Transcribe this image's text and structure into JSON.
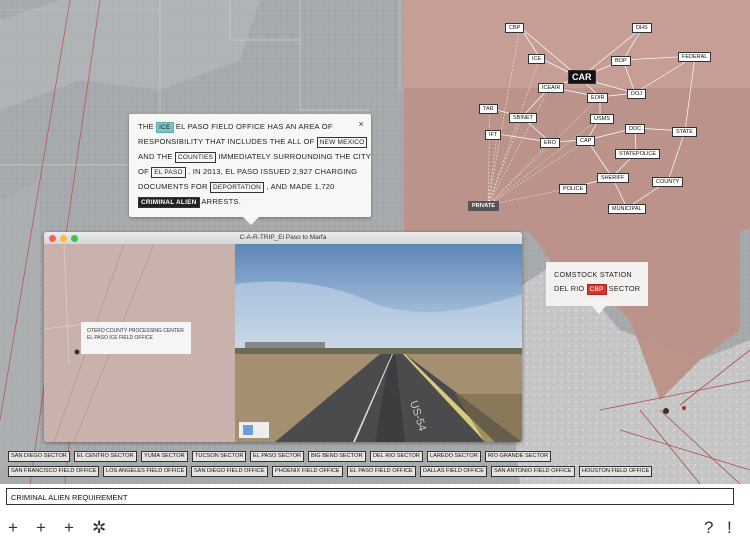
{
  "info_popup": {
    "segments": [
      {
        "type": "text",
        "v": "THE "
      },
      {
        "type": "tag",
        "cls": "ice",
        "v": "ICE"
      },
      {
        "type": "text",
        "v": " EL PASO FIELD OFFICE HAS AN AREA OF RESPONSIBILITY THAT INCLUDES THE ALL OF "
      },
      {
        "type": "tag",
        "cls": "",
        "v": "NEW MEXICO"
      },
      {
        "type": "text",
        "v": " AND THE "
      },
      {
        "type": "tag",
        "cls": "",
        "v": "COUNTIES"
      },
      {
        "type": "text",
        "v": " IMMEDIATELY SURROUNDING THE CITY OF "
      },
      {
        "type": "tag",
        "cls": "",
        "v": "EL PASO"
      },
      {
        "type": "text",
        "v": " . IN 2013, EL PASO ISSUED 2,927 CHARGING DOCUMENTS FOR "
      },
      {
        "type": "tag",
        "cls": "",
        "v": "DEPORTATION"
      },
      {
        "type": "text",
        "v": " , AND MADE 1,720 "
      },
      {
        "type": "tag",
        "cls": "dark",
        "v": "CRIMINAL ALIEN"
      },
      {
        "type": "text",
        "v": " ARRESTS."
      }
    ],
    "close_label": "×"
  },
  "video_window": {
    "title": "C-A-R-TRIP_El Paso to Marfa",
    "inner_popup_line1": "OTERO COUNTY PROCESSING CENTER",
    "inner_popup_line2": "EL PASO ICE FIELD OFFICE",
    "road_sign": "US-54"
  },
  "station_popup": {
    "line1": "COMSTOCK STATION",
    "prefix": "DEL RIO",
    "tag": "CBP",
    "suffix": "SECTOR"
  },
  "network_nodes": [
    {
      "id": "CBP",
      "label": "CBP"
    },
    {
      "id": "DHS",
      "label": "DHS"
    },
    {
      "id": "ICE",
      "label": "ICE"
    },
    {
      "id": "CAR",
      "label": "CAR"
    },
    {
      "id": "BOP",
      "label": "BOP"
    },
    {
      "id": "FEDERAL",
      "label": "FEDERAL"
    },
    {
      "id": "ICEAIR",
      "label": "ICEAIR"
    },
    {
      "id": "EOIR",
      "label": "EOIR"
    },
    {
      "id": "DOJ",
      "label": "DOJ"
    },
    {
      "id": "TAR",
      "label": "TAR"
    },
    {
      "id": "SBINET",
      "label": "SBINET"
    },
    {
      "id": "USMS",
      "label": "USMS"
    },
    {
      "id": "IFT",
      "label": "IFT"
    },
    {
      "id": "ERO",
      "label": "ERO"
    },
    {
      "id": "CAP",
      "label": "CAP"
    },
    {
      "id": "DOC",
      "label": "DOC"
    },
    {
      "id": "STATE",
      "label": "STATE"
    },
    {
      "id": "STATEPOLICE",
      "label": "STATEPOLICE"
    },
    {
      "id": "SHERIFF",
      "label": "SHERIFF"
    },
    {
      "id": "COUNTY",
      "label": "COUNTY"
    },
    {
      "id": "POLICE",
      "label": "POLICE"
    },
    {
      "id": "MUNICIPAL",
      "label": "MUNICIPAL"
    },
    {
      "id": "PRIVATE",
      "label": "PRIVATE"
    }
  ],
  "sectors": [
    "SAN DIEGO SECTOR",
    "EL CENTRO SECTOR",
    "YUMA SECTOR",
    "TUCSON SECTOR",
    "EL PASO SECTOR",
    "BIG BEND SECTOR",
    "DEL RIO SECTOR",
    "LAREDO SECTOR",
    "RIO GRANDE SECTOR"
  ],
  "field_offices": [
    "SAN FRANCISCO FIELD OFFICE",
    "LOS ANGELES FIELD OFFICE",
    "SAN DIEGO FIELD OFFICE",
    "PHOENIX FIELD OFFICE",
    "EL PASO FIELD OFFICE",
    "DALLAS FIELD OFFICE",
    "SAN ANTONIO FIELD OFFICE",
    "HOUSTON FIELD OFFICE"
  ],
  "search": {
    "value": "CRIMINAL ALIEN REQUIREMENT"
  },
  "toolbar": {
    "icons": [
      "+",
      "+",
      "+",
      "✲"
    ],
    "help": "?",
    "alert": "!"
  },
  "colors": {
    "territory": "#c79d93",
    "ice": "#7fc5c6",
    "cbp": "#d4372c",
    "road_line": "#a33"
  }
}
